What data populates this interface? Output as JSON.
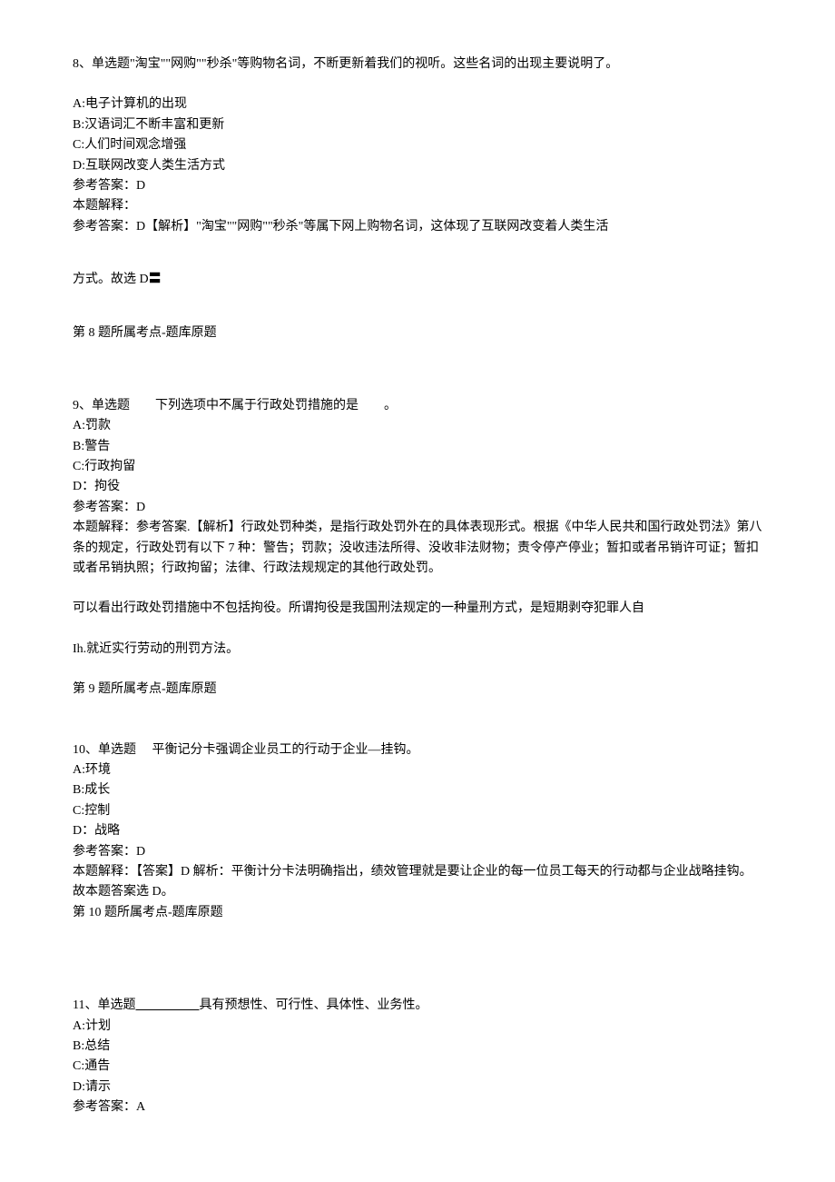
{
  "q8": {
    "title": "8、单选题\"淘宝\"\"网购\"\"秒杀\"等购物名词，不断更新着我们的视听。这些名词的出现主要说明了。",
    "a": "A:电子计算机的出现",
    "b": "B:汉语词汇不断丰富和更新",
    "c": "C:人们时间观念增强",
    "d": "D:互联网改变人类生活方式",
    "ans": "参考答案：D",
    "exp1": "本题解释：",
    "exp2": "参考答案：D【解析】\"淘宝\"\"网购\"\"秒杀\"等属下网上购物名词，这体现了互联网改变着人类生活",
    "exp3": "方式。故选 D〓",
    "topic": "第 8 题所属考点-题库原题"
  },
  "q9": {
    "title": "9、单选题　　下列选项中不属于行政处罚措施的是　　。",
    "a": "A:罚款",
    "b": "B:警告",
    "c": "C:行政拘留",
    "d": "D：拘役",
    "ans": "参考答案：D",
    "exp1": "本题解释：参考答案.【解析】行政处罚种类，是指行政处罚外在的具体表现形式。根据《中华人民共和国行政处罚法》第八条的规定，行政处罚有以下 7 种：警告；罚款；没收违法所得、没收非法财物；责令停产停业；暂扣或者吊销许可证；暂扣或者吊销执照；行政拘留；法律、行政法规规定的其他行政处罚。",
    "exp2": "可以看出行政处罚措施中不包括拘役。所谓拘役是我国刑法规定的一种量刑方式，是短期剥夺犯罪人自",
    "exp3": "Ih.就近实行劳动的刑罚方法。",
    "topic": "第 9 题所属考点-题库原题"
  },
  "q10": {
    "title": "10、单选题　 平衡记分卡强调企业员工的行动于企业―挂钩。",
    "a": "A:环境",
    "b": "B:成长",
    "c": "C:控制",
    "d": "D：战略",
    "ans": "参考答案：D",
    "exp1": "本题解释：【答案】D 解析：平衡计分卡法明确指出，绩效管理就是要让企业的每一位员工每天的行动都与企业战略挂钩。故本题答案选 D。",
    "topic": "第 10 题所属考点-题库原题"
  },
  "q11": {
    "title_pre": "11、单选题",
    "title_blank": "＿＿＿＿＿",
    "title_post": "具有预想性、可行性、具体性、业务性。",
    "a": "A:计划",
    "b": "B:总结",
    "c": "C:通告",
    "d": "D:请示",
    "ans": "参考答案：A"
  }
}
